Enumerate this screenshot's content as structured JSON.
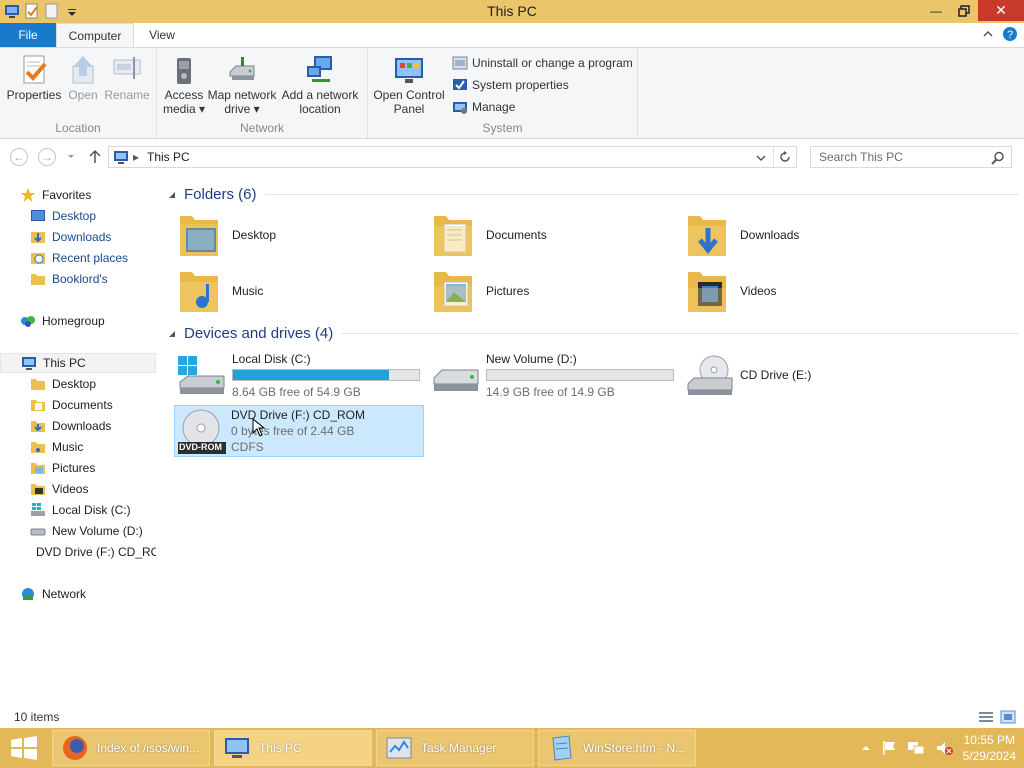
{
  "window": {
    "title": "This PC"
  },
  "tabs": [
    {
      "label": "File"
    },
    {
      "label": "Computer"
    },
    {
      "label": "View"
    }
  ],
  "ribbon": {
    "location": {
      "title": "Location",
      "properties": "Properties",
      "open": "Open",
      "rename": "Rename"
    },
    "network": {
      "title": "Network",
      "access_media_1": "Access",
      "access_media_2": "media ▾",
      "map_drive_1": "Map network",
      "map_drive_2": "drive ▾",
      "add_location_1": "Add a network",
      "add_location_2": "location"
    },
    "system": {
      "title": "System",
      "control_panel_1": "Open Control",
      "control_panel_2": "Panel",
      "uninstall": "Uninstall or change a program",
      "sys_props": "System properties",
      "manage": "Manage"
    }
  },
  "address": {
    "path": "This PC",
    "search_placeholder": "Search This PC"
  },
  "nav": {
    "favorites": "Favorites",
    "fav_items": [
      "Desktop",
      "Downloads",
      "Recent places",
      "Booklord's"
    ],
    "homegroup": "Homegroup",
    "thispc": "This PC",
    "pc_items": [
      "Desktop",
      "Documents",
      "Downloads",
      "Music",
      "Pictures",
      "Videos",
      "Local Disk (C:)",
      "New Volume (D:)",
      "DVD Drive (F:) CD_ROM"
    ],
    "network": "Network"
  },
  "folders_header": "Folders (6)",
  "folders": [
    "Desktop",
    "Documents",
    "Downloads",
    "Music",
    "Pictures",
    "Videos"
  ],
  "drives_header": "Devices and drives (4)",
  "drives": [
    {
      "name": "Local Disk (C:)",
      "free": "8.64 GB free of 54.9 GB",
      "used_fraction": 0.84
    },
    {
      "name": "New Volume (D:)",
      "free": "14.9 GB free of 14.9 GB",
      "used_fraction": 0.0
    },
    {
      "name": "CD Drive (E:)"
    },
    {
      "name": "DVD Drive (F:) CD_ROM",
      "free": "0 bytes free of 2.44 GB",
      "fs": "CDFS",
      "badge": "DVD-ROM"
    }
  ],
  "status": "10 items",
  "taskbar": {
    "items": [
      "Index of /isos/win...",
      "This PC",
      "Task Manager",
      "WinStore.htm - N..."
    ],
    "time": "10:55 PM",
    "date": "5/29/2024"
  },
  "colors": {
    "accent": "#1979ca",
    "titlebar": "#ebc56a",
    "taskbar": "#e2b858",
    "bar_fill": "#26a0da",
    "selection": "#cce8ff"
  }
}
